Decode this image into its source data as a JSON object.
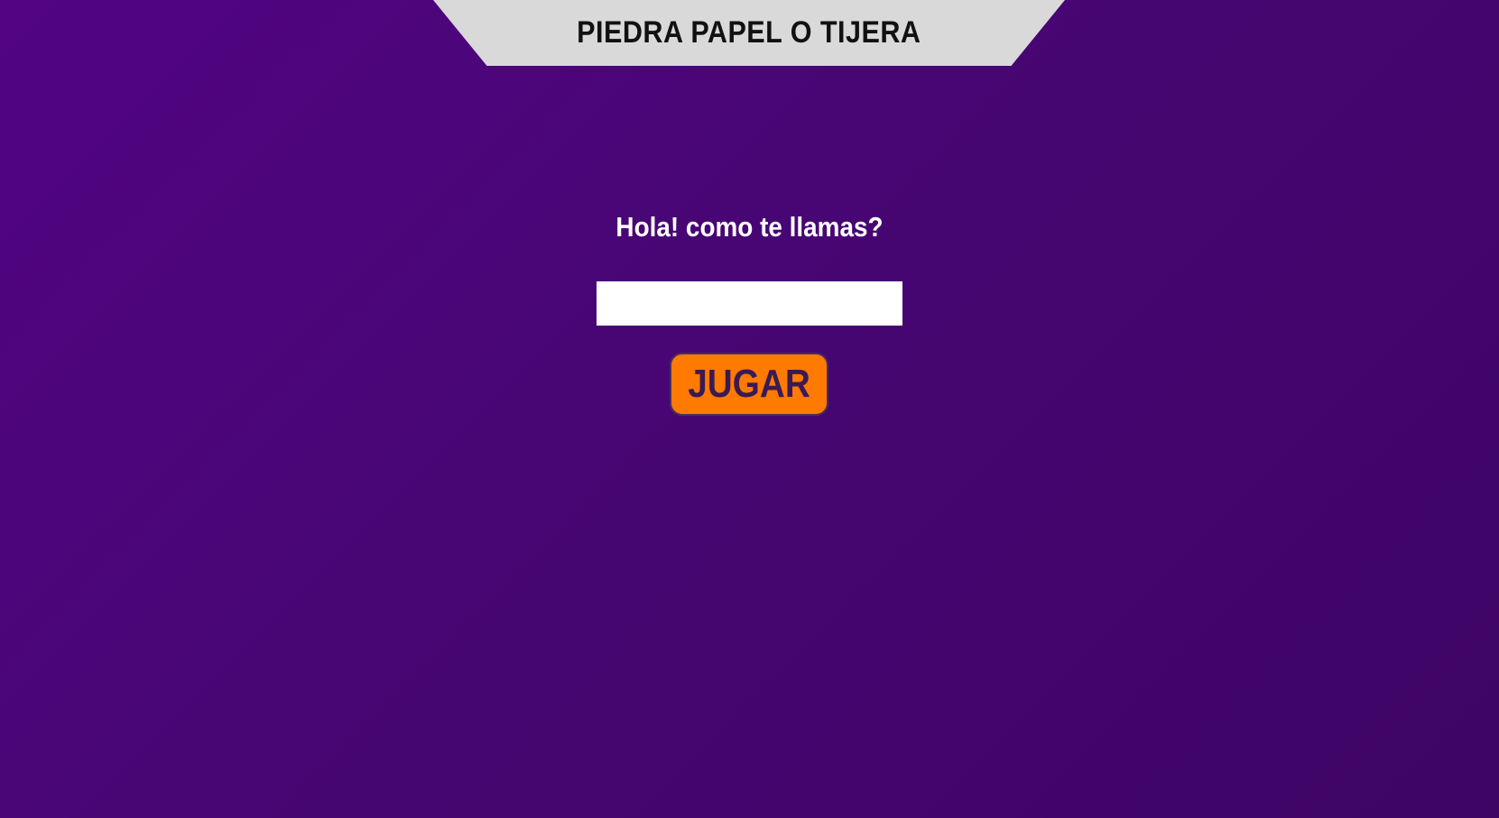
{
  "header": {
    "title": "PIEDRA PAPEL O TIJERA"
  },
  "form": {
    "prompt": "Hola! como te llamas?",
    "name_value": "",
    "name_placeholder": "",
    "play_label": "JUGAR"
  },
  "colors": {
    "background": "#4a0676",
    "banner": "#d9d9d9",
    "button": "#ff7a00",
    "button_text": "#3a1a55",
    "text": "#ffffff"
  }
}
